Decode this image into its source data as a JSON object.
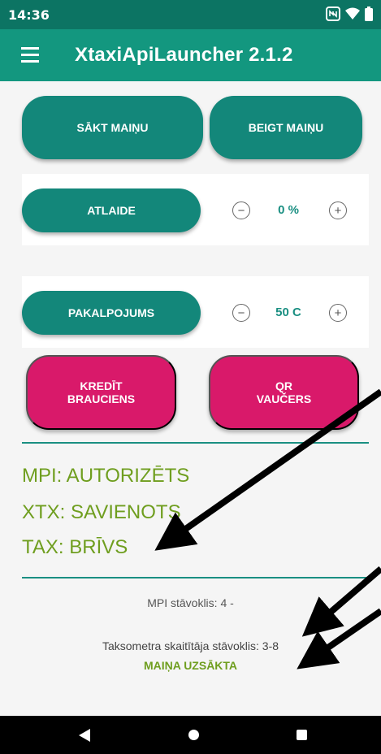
{
  "status_bar": {
    "time": "14:36",
    "icons": [
      "nfc-icon",
      "wifi-icon",
      "battery-icon"
    ]
  },
  "app_bar": {
    "title": "XtaxiApiLauncher 2.1.2",
    "menu_icon": "hamburger-menu-icon"
  },
  "shift": {
    "start_label": "SĀKT MAIŅU",
    "end_label": "BEIGT MAIŅU"
  },
  "discount": {
    "button_label": "ATLAIDE",
    "value": "0 %"
  },
  "service": {
    "button_label": "PAKALPOJUMS",
    "value": "50 C"
  },
  "actions": {
    "credit_label": "KREDĪT\nBRAUCIENS",
    "qr_label": "QR\nVAUČERS"
  },
  "status": {
    "mpi": "MPI: AUTORIZĒTS",
    "xtx": "XTX: SAVIENOTS",
    "tax": "TAX: BRĪVS"
  },
  "info": {
    "mpi_state": "MPI stāvoklis: 4 -",
    "taximeter_state": "Taksometra skaitītāja stāvoklis: 3-8",
    "shift_state": "MAIŅA UZSĀKTA"
  },
  "colors": {
    "status_bar": "#0c7463",
    "app_bar": "#13977f",
    "teal_button": "#13877a",
    "pink_button": "#d9196a",
    "status_green": "#6f9e1f",
    "value_teal": "#1a8f82"
  }
}
